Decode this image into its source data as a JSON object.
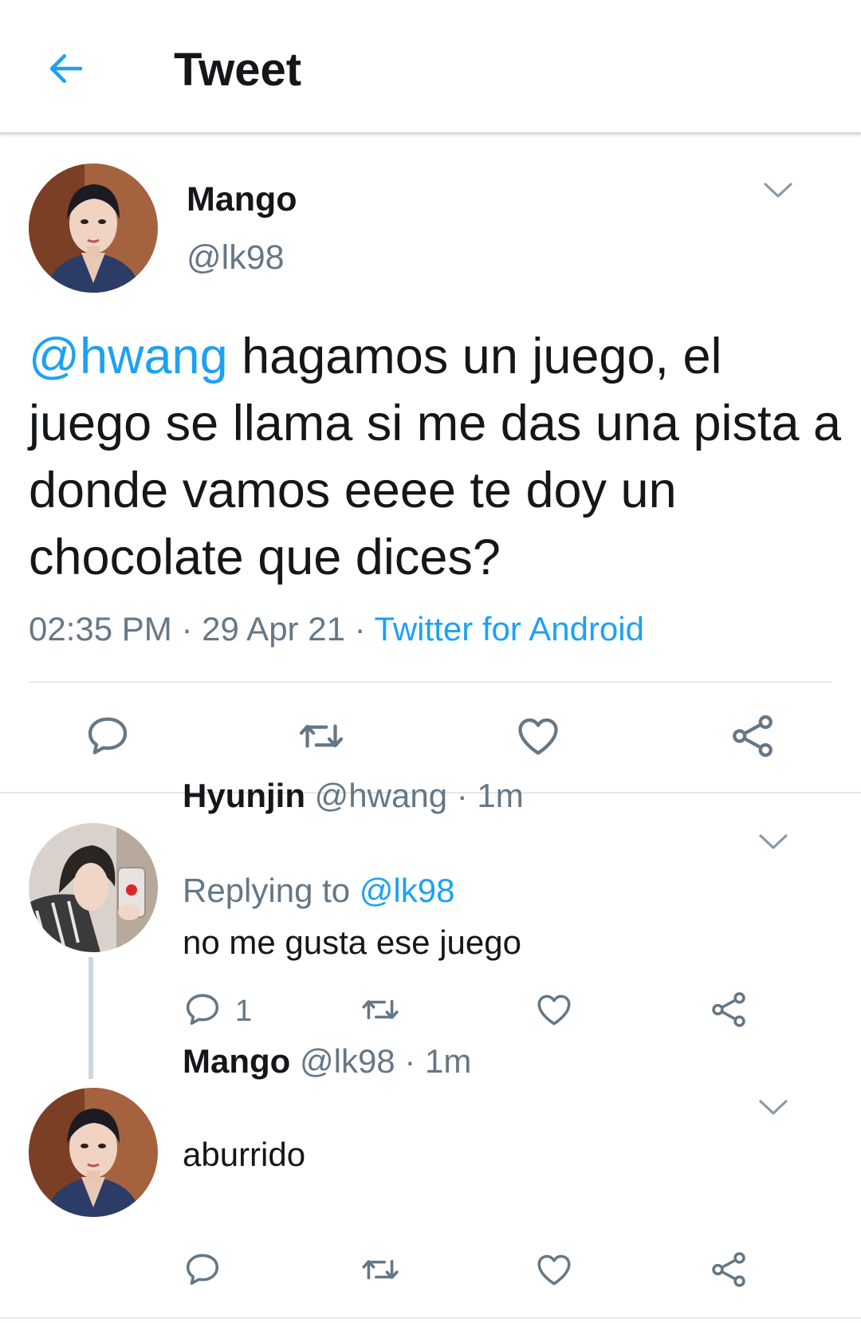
{
  "header": {
    "title": "Tweet"
  },
  "main_tweet": {
    "name": "Mango",
    "handle": "@lk98",
    "mention": "@hwang",
    "text": " hagamos un juego, el juego se llama si me das una pista a donde vamos eeee te doy un chocolate que dices?",
    "time": "02:35 PM",
    "separator1": " · ",
    "date": "29 Apr 21",
    "separator2": " · ",
    "source": "Twitter for Android"
  },
  "replies": [
    {
      "name": "Hyunjin",
      "handle": "@hwang",
      "sep": " · ",
      "age": "1m",
      "replying_prefix": "Replying to ",
      "replying_to": "@lk98",
      "text": "no me gusta ese juego",
      "reply_count": "1"
    },
    {
      "name": "Mango",
      "handle": "@lk98",
      "sep": " · ",
      "age": "1m",
      "text": "aburrido"
    }
  ],
  "colors": {
    "accent": "#1da1f2",
    "secondary_text": "#657786",
    "icon": "#657786",
    "divider": "#e1e8ed"
  },
  "icons": {
    "back": "arrow-left-icon",
    "caret": "chevron-down-icon",
    "reply": "comment-icon",
    "retweet": "retweet-icon",
    "like": "heart-icon",
    "share": "share-icon"
  }
}
